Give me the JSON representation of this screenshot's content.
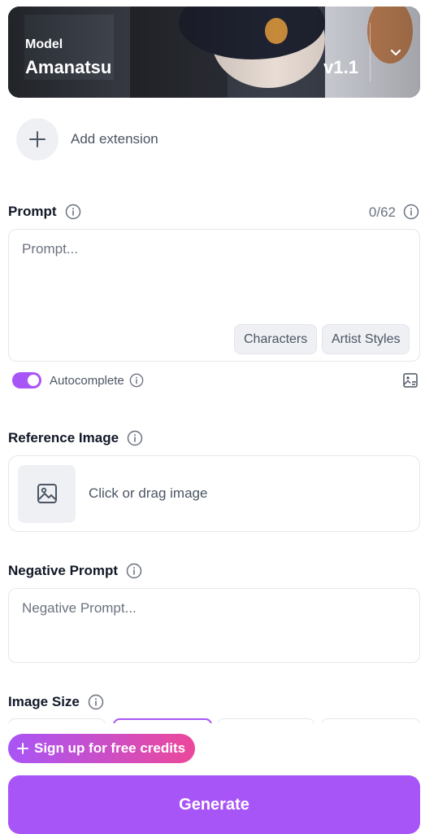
{
  "model": {
    "caption": "Model",
    "name": "Amanatsu",
    "version": "v1.1"
  },
  "extension": {
    "label": "Add extension"
  },
  "prompt": {
    "label": "Prompt",
    "counter": "0/62",
    "placeholder": "Prompt...",
    "chips": [
      "Characters",
      "Artist Styles"
    ],
    "autocomplete_label": "Autocomplete",
    "autocomplete_on": true
  },
  "reference_image": {
    "label": "Reference Image",
    "dropzone_text": "Click or drag image"
  },
  "negative_prompt": {
    "label": "Negative Prompt",
    "placeholder": "Negative Prompt..."
  },
  "image_size": {
    "label": "Image Size"
  },
  "actions": {
    "signup_label": "Sign up for free credits",
    "generate_label": "Generate"
  },
  "colors": {
    "accent": "#a855f7",
    "signup_gradient_end": "#ec4899",
    "muted_text": "#6b7280"
  }
}
